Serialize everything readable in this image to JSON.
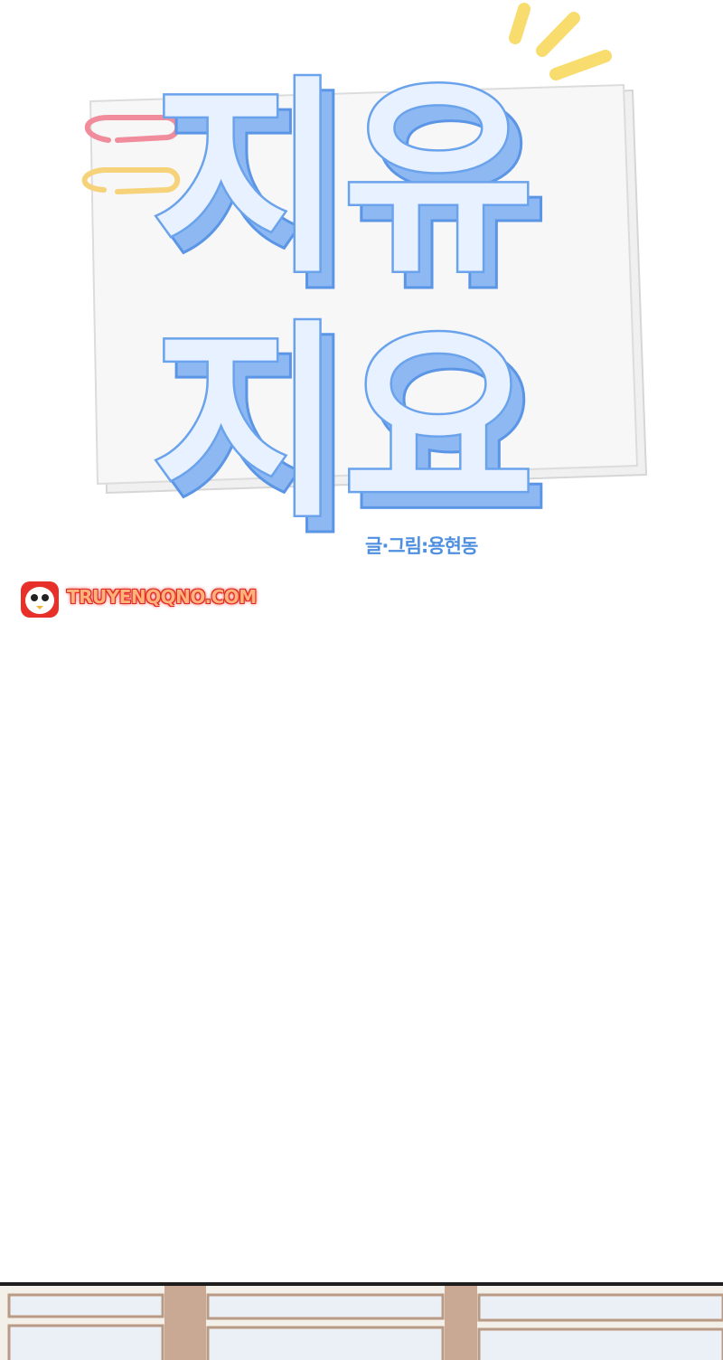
{
  "title": {
    "line1": "지유",
    "line2": "지요",
    "colors": {
      "fill": "#e8f1ff",
      "shadow": "#8db8f2",
      "outline": "#5b95e6",
      "paper": "#f3f3f3",
      "paperclip_pink": "#f08c9c",
      "paperclip_yellow": "#f6d37a",
      "sparkle": "#f9dc6e"
    }
  },
  "credit": "글·그림:용현동",
  "watermark": {
    "text": "TRUYENQQNO.COM",
    "logo": "penguin-logo",
    "colors": {
      "glow": "#e8302a",
      "text": "#ffb27a"
    }
  },
  "scene": {
    "description_icon": "window-frame",
    "colors": {
      "frame": "#b89a85",
      "glass": "#eaf0f5"
    }
  }
}
